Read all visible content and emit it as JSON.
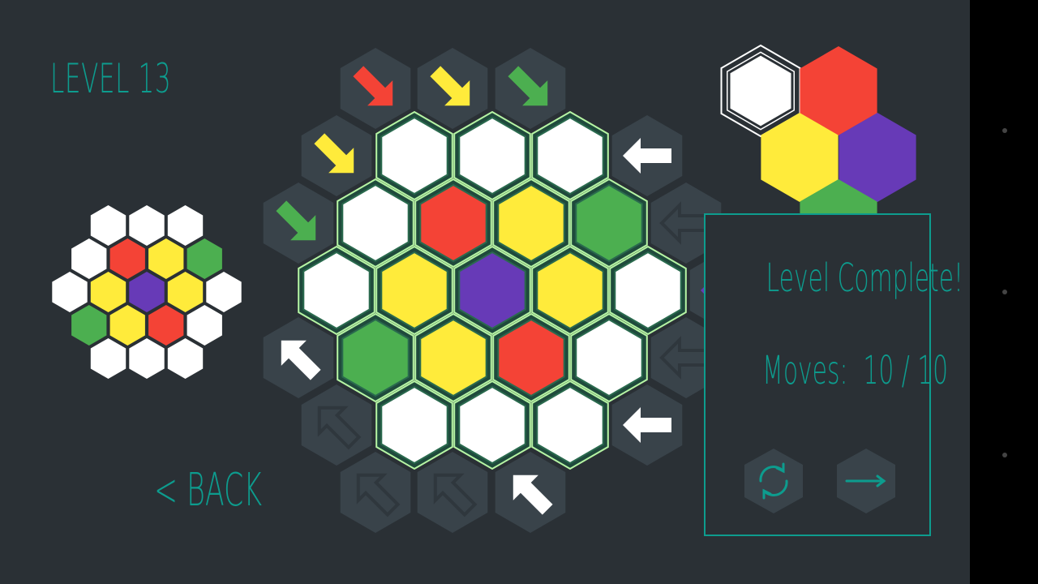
{
  "header": {
    "level_label": "LEVEL 13"
  },
  "nav": {
    "back_label": "< BACK"
  },
  "result_panel": {
    "title": "Level Complete!",
    "moves_label": "Moves:",
    "moves_value": "10 / 10",
    "restart_icon": "restart-icon",
    "next_icon": "arrow-right-icon"
  },
  "colors": {
    "background": "#2a3035",
    "accent": "#0d9c8e",
    "red": "#f44336",
    "yellow": "#ffeb3b",
    "green": "#4caf50",
    "purple": "#673ab7",
    "white": "#ffffff",
    "arrow_tile": "#39434a",
    "glow": "#b6f5a4"
  },
  "board": {
    "rows": [
      [
        "white",
        "white",
        "white"
      ],
      [
        "white",
        "red",
        "yellow",
        "green"
      ],
      [
        "white",
        "yellow",
        "purple",
        "yellow",
        "white"
      ],
      [
        "green",
        "yellow",
        "red",
        "white"
      ],
      [
        "white",
        "white",
        "white"
      ]
    ]
  },
  "target_pattern": {
    "rows": [
      [
        "white",
        "white",
        "white"
      ],
      [
        "white",
        "red",
        "yellow",
        "green"
      ],
      [
        "white",
        "yellow",
        "purple",
        "yellow",
        "white"
      ],
      [
        "green",
        "yellow",
        "red",
        "white"
      ],
      [
        "white",
        "white",
        "white"
      ]
    ]
  },
  "arrow_tiles": [
    {
      "id": "top-1",
      "color": "red",
      "direction": "down-right",
      "active": true
    },
    {
      "id": "top-2",
      "color": "yellow",
      "direction": "down-right",
      "active": true
    },
    {
      "id": "top-3",
      "color": "green",
      "direction": "down-right",
      "active": true
    },
    {
      "id": "upper-left-1",
      "color": "yellow",
      "direction": "down-right",
      "active": true
    },
    {
      "id": "upper-left-2",
      "color": "green",
      "direction": "down-right",
      "active": true
    },
    {
      "id": "right-1",
      "color": "white",
      "direction": "left",
      "active": true
    },
    {
      "id": "right-2",
      "color": "",
      "direction": "left",
      "active": false
    },
    {
      "id": "right-3",
      "color": "purple",
      "direction": "left",
      "active": true
    },
    {
      "id": "right-4",
      "color": "",
      "direction": "left",
      "active": false
    },
    {
      "id": "right-5",
      "color": "white",
      "direction": "left",
      "active": true
    },
    {
      "id": "lower-left-1",
      "color": "white",
      "direction": "up-left",
      "active": true
    },
    {
      "id": "lower-left-2",
      "color": "",
      "direction": "up-left",
      "active": false
    },
    {
      "id": "bottom-1",
      "color": "",
      "direction": "up-left",
      "active": false
    },
    {
      "id": "bottom-2",
      "color": "",
      "direction": "up-left",
      "active": false
    },
    {
      "id": "bottom-3",
      "color": "white",
      "direction": "up-left",
      "active": true
    }
  ],
  "palette": [
    "white",
    "red",
    "yellow",
    "purple",
    "green"
  ],
  "palette_selected": "white"
}
